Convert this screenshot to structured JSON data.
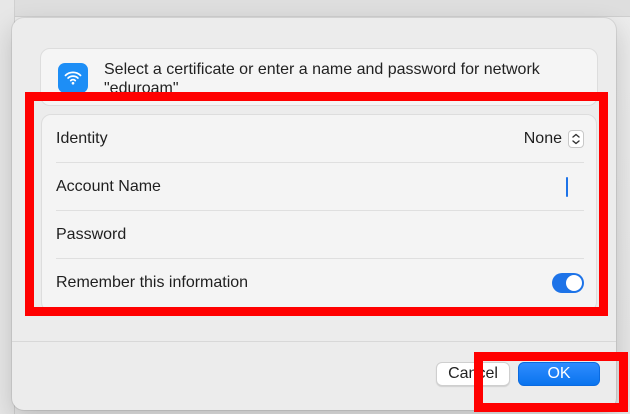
{
  "dialog": {
    "header_text": "Select a certificate or enter a name and password for network \"eduroam\""
  },
  "form": {
    "identity": {
      "label": "Identity",
      "value": "None"
    },
    "account_name": {
      "label": "Account Name",
      "value": ""
    },
    "password": {
      "label": "Password",
      "value": ""
    },
    "remember": {
      "label": "Remember this information",
      "enabled": true
    }
  },
  "buttons": {
    "cancel": "Cancel",
    "ok": "OK"
  },
  "icons": {
    "wifi": "wifi-icon",
    "stepper": "chevron-up-down-icon"
  },
  "colors": {
    "accent": "#1d73e8",
    "highlight": "#ff0000"
  }
}
